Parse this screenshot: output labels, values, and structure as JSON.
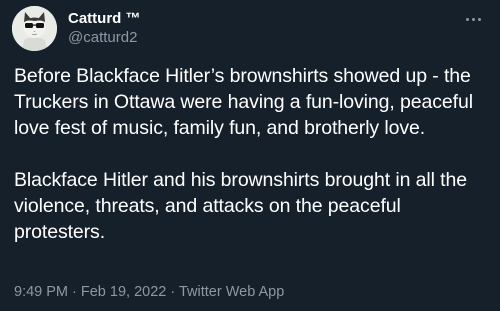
{
  "author": {
    "display_name": "Catturd ™",
    "handle": "@catturd2"
  },
  "tweet": {
    "paragraph_1": "Before Blackface Hitler’s brownshirts showed up - the Truckers in Ottawa were having a fun-loving, peaceful love fest of music, family fun, and brotherly love.",
    "paragraph_2": "Blackface Hitler and his brownshirts brought in all the violence, threats, and attacks on the peaceful protesters."
  },
  "meta": {
    "time": "9:49 PM",
    "separator": "·",
    "date": "Feb 19, 2022",
    "source": "Twitter Web App"
  },
  "icons": {
    "more": "more-dots-icon"
  },
  "colors": {
    "background": "#15202b",
    "text": "#ffffff",
    "secondary": "#8b98a5"
  }
}
